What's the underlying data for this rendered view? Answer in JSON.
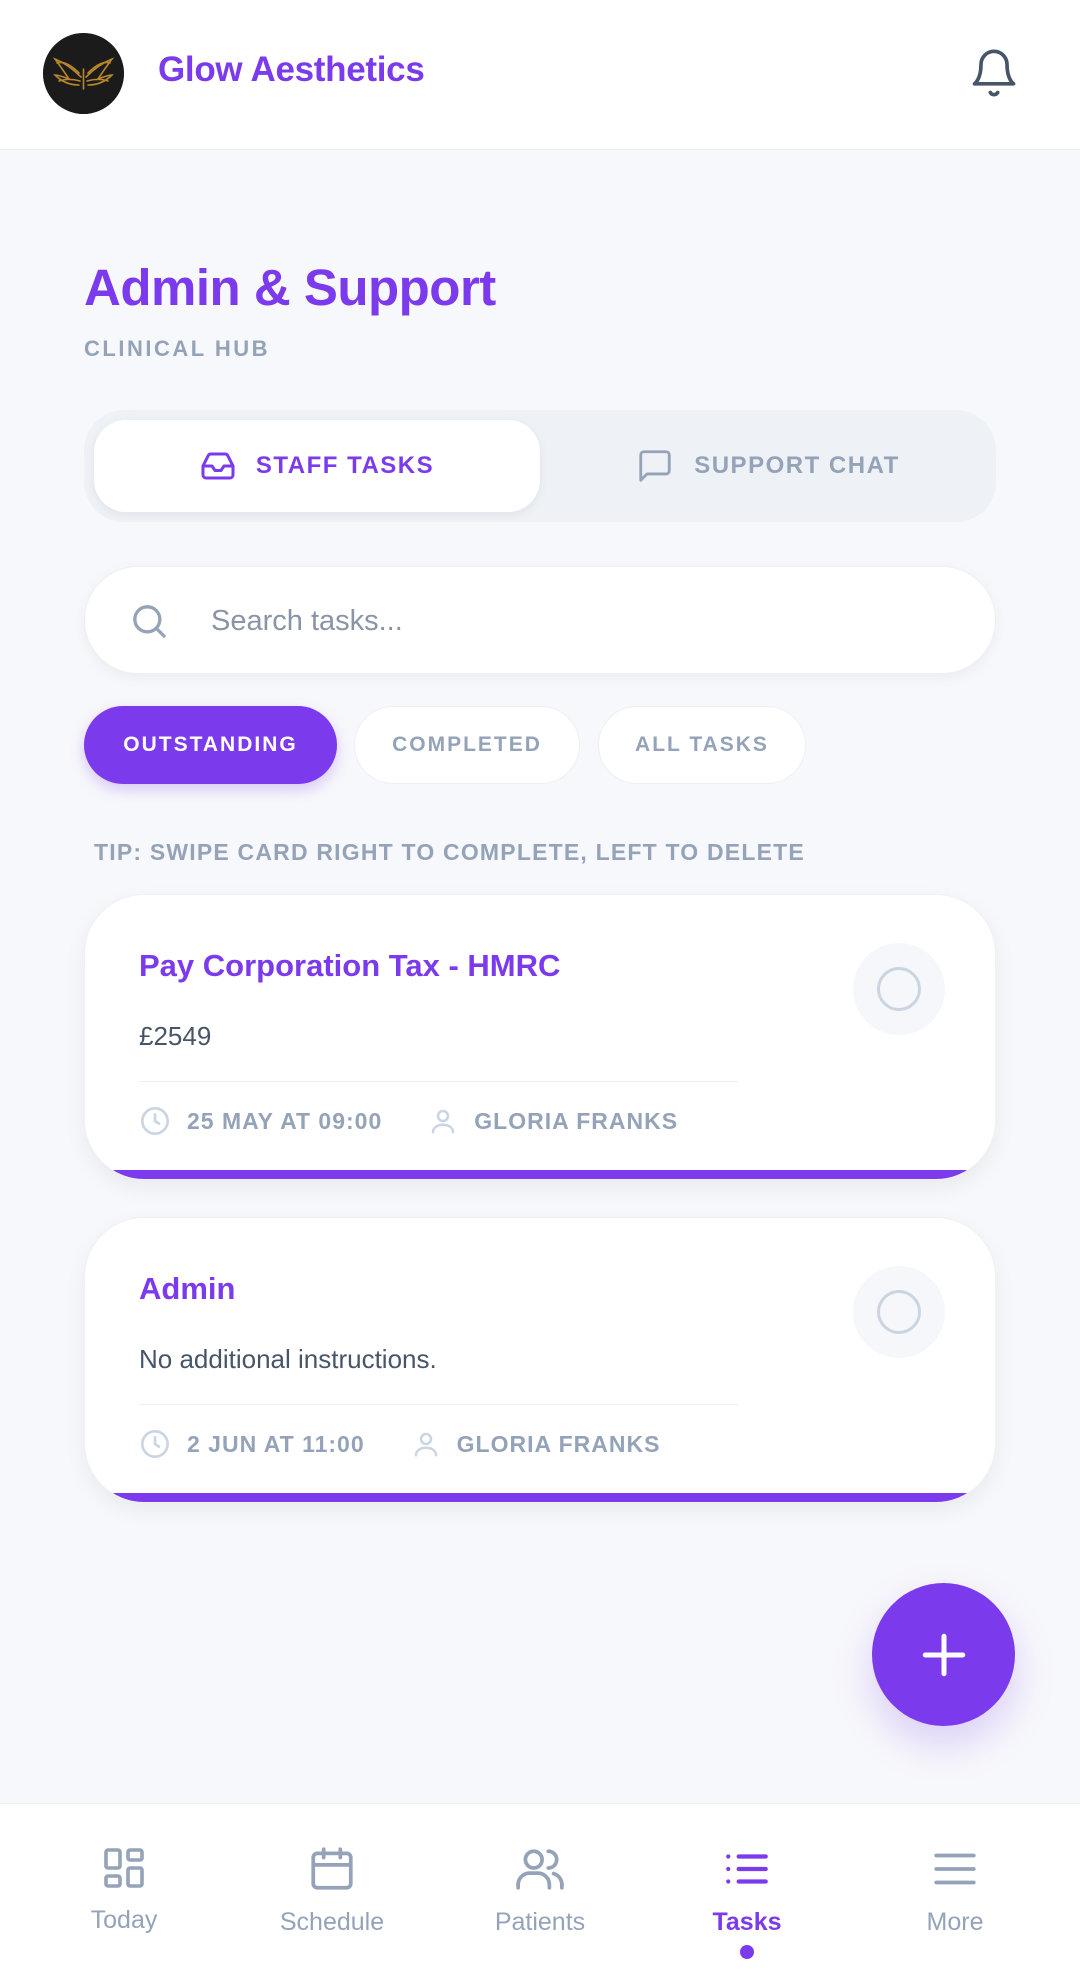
{
  "header": {
    "brand": "Glow Aesthetics",
    "logo_icon": "winged-logo-icon",
    "notification_icon": "bell-icon"
  },
  "page": {
    "title": "Admin & Support",
    "subtitle": "CLINICAL HUB"
  },
  "segments": [
    {
      "label": "STAFF TASKS",
      "icon": "inbox-icon",
      "active": true
    },
    {
      "label": "SUPPORT CHAT",
      "icon": "chat-bubble-icon",
      "active": false
    }
  ],
  "search": {
    "placeholder": "Search tasks...",
    "value": ""
  },
  "filters": [
    {
      "label": "OUTSTANDING",
      "active": true
    },
    {
      "label": "COMPLETED",
      "active": false
    },
    {
      "label": "ALL TASKS",
      "active": false
    }
  ],
  "tip": "TIP: SWIPE CARD RIGHT TO COMPLETE, LEFT TO DELETE",
  "tasks": [
    {
      "title": "Pay Corporation Tax - HMRC",
      "description": "£2549",
      "due": "25 MAY AT 09:00",
      "assignee": "GLORIA FRANKS",
      "completed": false
    },
    {
      "title": "Admin",
      "description": "No additional instructions.",
      "due": "2 JUN AT 11:00",
      "assignee": "GLORIA FRANKS",
      "completed": false
    }
  ],
  "fab": {
    "icon": "plus-icon"
  },
  "tabbar": {
    "items": [
      {
        "label": "Today",
        "icon": "grid-icon",
        "active": false
      },
      {
        "label": "Schedule",
        "icon": "calendar-icon",
        "active": false
      },
      {
        "label": "Patients",
        "icon": "users-icon",
        "active": false
      },
      {
        "label": "Tasks",
        "icon": "list-icon",
        "active": true
      },
      {
        "label": "More",
        "icon": "menu-icon",
        "active": false
      }
    ]
  },
  "colors": {
    "accent": "#7c3aed",
    "muted": "#94a3b8",
    "background": "#f7f8fb"
  }
}
